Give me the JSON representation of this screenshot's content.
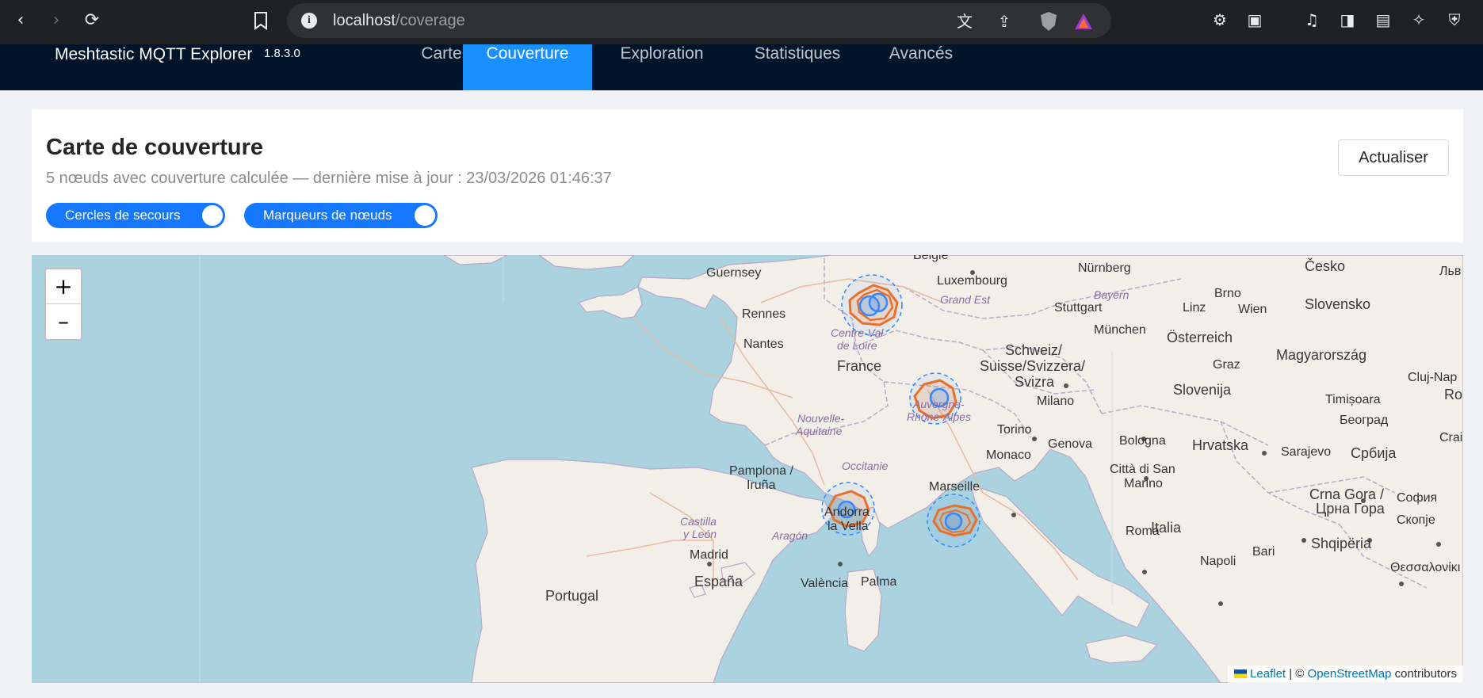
{
  "browser": {
    "url_host": "localhost",
    "url_path": "/coverage"
  },
  "header": {
    "title": "Meshtastic MQTT Explorer",
    "version": "1.8.3.0",
    "tabs": [
      {
        "label": "Carte",
        "active": false
      },
      {
        "label": "Couverture",
        "active": true
      },
      {
        "label": "Exploration",
        "active": false
      },
      {
        "label": "Statistiques",
        "active": false
      },
      {
        "label": "Avancés",
        "active": false
      }
    ]
  },
  "panel": {
    "title": "Carte de couverture",
    "subtitle": "5 nœuds avec couverture calculée — dernière mise à jour : 23/03/2026 01:46:37",
    "refresh_label": "Actualiser",
    "toggles": [
      {
        "label": "Cercles de secours",
        "on": true
      },
      {
        "label": "Marqueurs de nœuds",
        "on": true
      }
    ]
  },
  "map": {
    "zoom_in": "+",
    "zoom_out": "–",
    "attribution": {
      "leaflet": "Leaflet",
      "separator": " | © ",
      "osm": "OpenStreetMap",
      "suffix": " contributors"
    },
    "labels": {
      "belgien": "België",
      "cesko": "Česko",
      "lwow": "Льв",
      "guernsey": "Guernsey",
      "luxembourg": "Luxembourg",
      "nurnberg": "Nürnberg",
      "grand_est": "Grand Est",
      "bayern": "Bayern",
      "brno": "Brno",
      "stuttgart": "Stuttgart",
      "linz": "Linz",
      "wien": "Wien",
      "slovensko": "Slovensko",
      "rennes": "Rennes",
      "munchen": "München",
      "centre_val": "Centre-Val",
      "de_loire": "de Loire",
      "nantes": "Nantes",
      "schweiz": "Schweiz/",
      "suisse": "Suisse/Svizzera/",
      "svizra": "Svizra",
      "osterreich": "Österreich",
      "magyarorszag": "Magyarország",
      "france": "France",
      "graz": "Graz",
      "cluj": "Cluj-Nap",
      "rom": "Rom",
      "slovenija": "Slovenija",
      "milano": "Milano",
      "timisoara": "Timișoara",
      "auvergne": "Auvergne-",
      "rhone_alpes": "Rhône-Alpes",
      "nouvelle": "Nouvelle-",
      "aquitaine": "Aquitaine",
      "beograd": "Београд",
      "torino": "Torino",
      "bologna": "Bologna",
      "hrvatska": "Hrvatska",
      "craiova": "Craio",
      "monaco": "Monaco",
      "genova": "Genova",
      "sarajevo": "Sarajevo",
      "srbija": "Србија",
      "pamplona": "Pamplona /",
      "iruna": "Iruña",
      "occitanie": "Occitanie",
      "citta": "Città di San",
      "marino": "Marino",
      "marseille": "Marseille",
      "crna_gora": "Crna Gora /",
      "crna_gora_cyr": "Црна Гора",
      "sofia": "София",
      "skopje": "Скопје",
      "andorra": "Andorra",
      "la_vella": "la Vella",
      "castilla": "Castilla",
      "y_leon": "y León",
      "aragon": "Aragón",
      "italia": "Italia",
      "roma": "Roma",
      "bari": "Bari",
      "shqiperia": "Shqipëria",
      "madrid": "Madrid",
      "napoli": "Napoli",
      "espana": "España",
      "valencia": "València",
      "palma": "Palma",
      "thessaloniki": "Θεσσαλονίκι",
      "portugal": "Portugal"
    }
  },
  "colors": {
    "primary": "#1677ff",
    "header_bg": "#001529",
    "tab_active": "#1890ff",
    "sea": "#aad3df",
    "land": "#f2efe9",
    "coverage_orange": "#e8702a",
    "node_blue": "#3388ff"
  }
}
